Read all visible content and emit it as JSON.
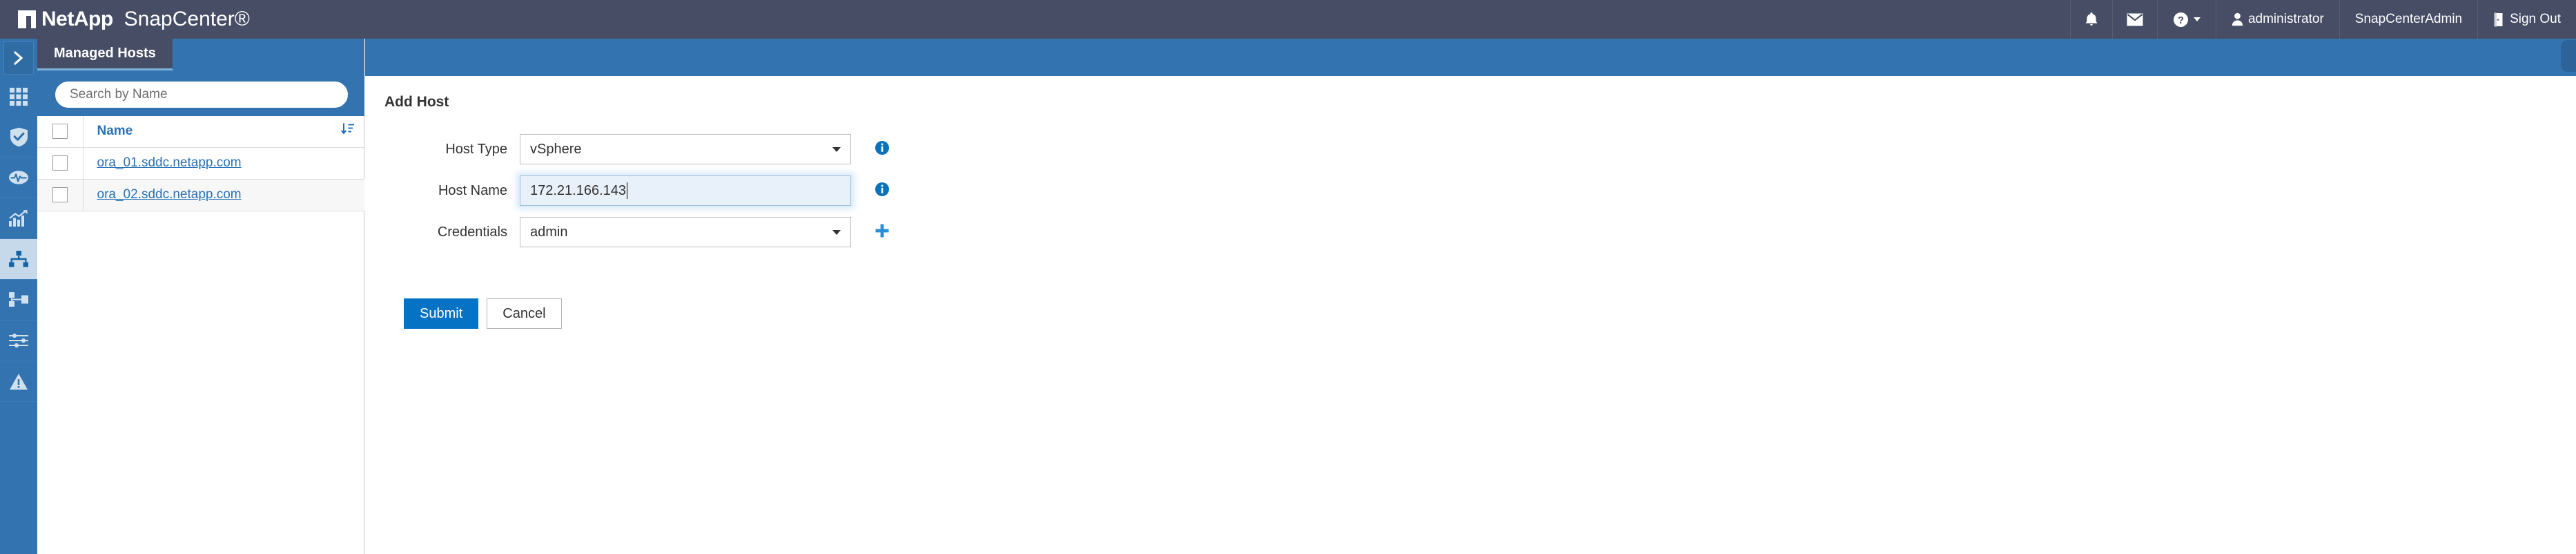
{
  "header": {
    "brand_netapp": "NetApp",
    "brand_product": "SnapCenter®",
    "notifications_icon": "bell-icon",
    "messages_icon": "envelope-icon",
    "help_icon": "help-circle-icon",
    "user_icon": "user-icon",
    "user_name": "administrator",
    "role_name": "SnapCenterAdmin",
    "signout_icon": "exit-door-icon",
    "signout_label": "Sign Out",
    "background_color": "#464d65"
  },
  "sidebar": {
    "background_color": "#3273b0",
    "active_background_color": "#c5d9ea",
    "items": [
      {
        "name": "expand-rail",
        "icon": "chevron-right-icon",
        "active": false
      },
      {
        "name": "dashboard",
        "icon": "grid-dashboard-icon",
        "active": false
      },
      {
        "name": "resources",
        "icon": "shield-check-icon",
        "active": false
      },
      {
        "name": "monitor",
        "icon": "pulse-monitor-icon",
        "active": false
      },
      {
        "name": "reports",
        "icon": "bar-chart-trend-icon",
        "active": false
      },
      {
        "name": "hosts",
        "icon": "hosts-hierarchy-icon",
        "active": true
      },
      {
        "name": "storage-systems",
        "icon": "storage-nodes-icon",
        "active": false
      },
      {
        "name": "settings",
        "icon": "sliders-icon",
        "active": false
      },
      {
        "name": "alerts",
        "icon": "warning-triangle-icon",
        "active": false
      }
    ]
  },
  "left_panel": {
    "tab_label": "Managed Hosts",
    "search": {
      "placeholder": "Search by Name",
      "value": ""
    },
    "table": {
      "columns": [
        "Name"
      ],
      "sort_icon": "sort-descending-icon",
      "rows": [
        {
          "name": "ora_01.sddc.netapp.com",
          "checked": false
        },
        {
          "name": "ora_02.sddc.netapp.com",
          "checked": false
        }
      ]
    }
  },
  "main": {
    "title": "Add Host",
    "fields": [
      {
        "label": "Host Type",
        "value": "vSphere",
        "type": "select",
        "focused": false,
        "adornment": "info-icon"
      },
      {
        "label": "Host Name",
        "value": "172.21.166.143",
        "type": "text",
        "focused": true,
        "adornment": "info-icon"
      },
      {
        "label": "Credentials",
        "value": "admin",
        "type": "select",
        "focused": false,
        "adornment": "plus-icon"
      }
    ],
    "buttons": {
      "submit_label": "Submit",
      "cancel_label": "Cancel",
      "submit_color": "#0572c4"
    }
  }
}
